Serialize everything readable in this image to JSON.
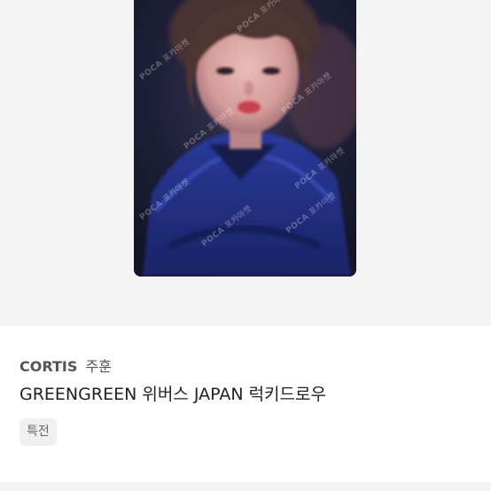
{
  "product": {
    "image_alt": "photocard",
    "watermark": "POCA 포카마켓",
    "artist": "CORTIS",
    "member": "주훈",
    "title": "GREENGREEN 위버스 JAPAN 럭키드로우",
    "tag": "특전"
  },
  "colors": {
    "image_bg": "#f4f4f4",
    "card_bg": "#1b1d36",
    "jacket": "#21348c",
    "tag_bg": "#f0f0f0"
  }
}
